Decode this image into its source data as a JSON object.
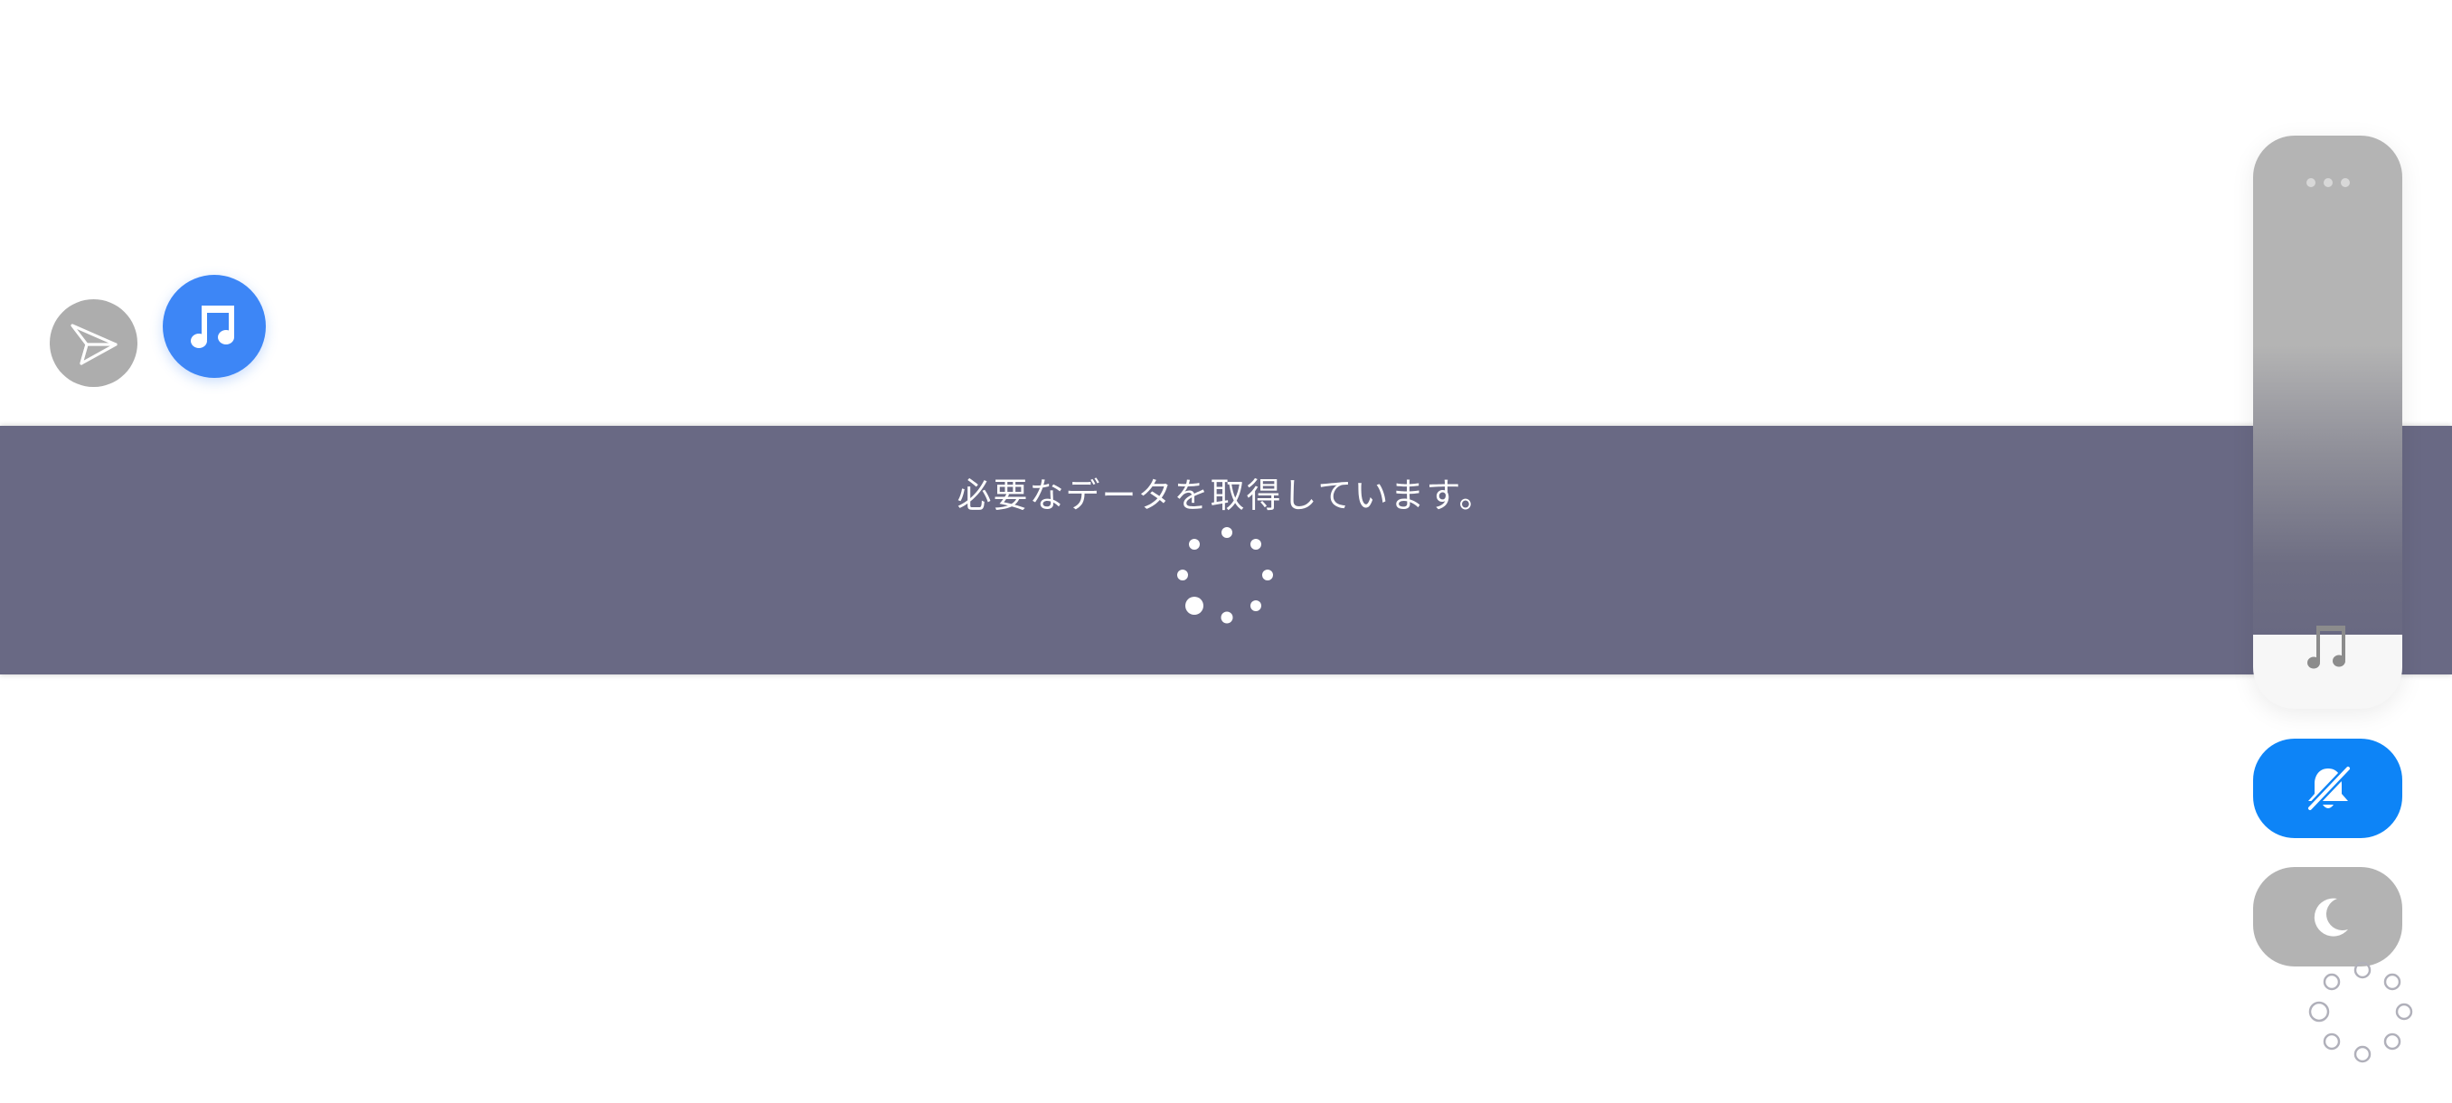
{
  "loading": {
    "message": "必要なデータを取得しています。"
  },
  "volume": {
    "level_percent": 87
  },
  "icons": {
    "share": "send-plane-icon",
    "music": "music-note-icon",
    "more": "more-horizontal-icon",
    "mute": "bell-off-icon",
    "night_mode": "moon-icon"
  },
  "colors": {
    "banner": "#696984",
    "music_accent": "#3d86f6",
    "mute_active": "#0d84f7",
    "inactive_gray": "#adadad"
  }
}
